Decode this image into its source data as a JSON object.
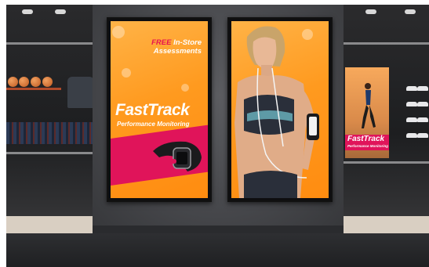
{
  "left_screen": {
    "free_label": "FREE",
    "offer_line1": "In-Store",
    "offer_line2": "Assessments",
    "brand": "FastTrack",
    "tagline": "Performance Monitoring"
  },
  "mini_ad": {
    "brand": "FastTrack",
    "tagline": "Performance Monitoring"
  },
  "colors": {
    "accent_orange": "#ff9a1f",
    "accent_pink": "#e0145a",
    "wall": "#4a4b4f"
  },
  "objects": {
    "fitness_band": "fitness-band-icon",
    "runner": "runner-icon"
  }
}
